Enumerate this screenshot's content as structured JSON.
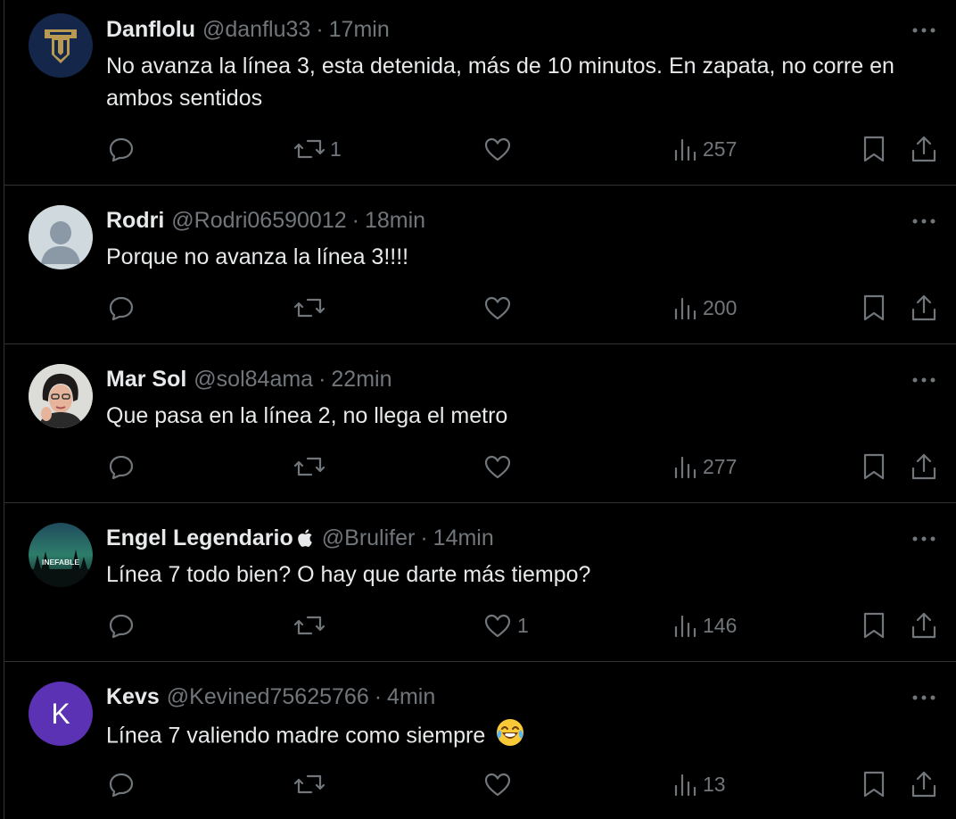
{
  "colors": {
    "background": "#000000",
    "text_primary": "#e7e9ea",
    "text_secondary": "#71767b",
    "divider": "#2f3336",
    "kevs_avatar": "#5b32b4"
  },
  "tweets": [
    {
      "name": "Danflolu",
      "handle": "@danflu33",
      "separator": "·",
      "time": "17min",
      "text": "No avanza la línea 3, esta detenida, más de 10 minutos. En zapata, no corre en ambos sentidos",
      "avatar": "pumas-logo",
      "replies": "",
      "reposts": "1",
      "likes": "",
      "views": "257"
    },
    {
      "name": "Rodri",
      "handle": "@Rodri06590012",
      "separator": "·",
      "time": "18min",
      "text": "Porque no avanza la línea 3!!!!",
      "avatar": "default-person",
      "replies": "",
      "reposts": "",
      "likes": "",
      "views": "200"
    },
    {
      "name": "Mar Sol",
      "handle": "@sol84ama",
      "separator": "·",
      "time": "22min",
      "text": "Que pasa en la línea 2, no llega el metro",
      "avatar": "woman-photo",
      "replies": "",
      "reposts": "",
      "likes": "",
      "views": "277"
    },
    {
      "name": "Engel Legendario",
      "handle": "@Brulifer",
      "separator": "·",
      "time": "14min",
      "text": "Línea 7 todo bien? O hay que darte más tiempo?",
      "avatar": "inefable-forest",
      "avatar_text": "INEFABLE",
      "badge_icon": "apple-icon",
      "replies": "",
      "reposts": "",
      "likes": "1",
      "views": "146"
    },
    {
      "name": "Kevs",
      "handle": "@Kevined75625766",
      "separator": "·",
      "time": "4min",
      "text": "Línea 7 valiendo madre como siempre",
      "emoji": "😂",
      "avatar": "letter-k",
      "avatar_letter": "K",
      "replies": "",
      "reposts": "",
      "likes": "",
      "views": "13"
    }
  ],
  "icons": {
    "reply": "reply-icon",
    "repost": "repost-icon",
    "like": "heart-icon",
    "views": "views-icon",
    "bookmark": "bookmark-icon",
    "share": "share-icon",
    "more": "more-icon"
  }
}
